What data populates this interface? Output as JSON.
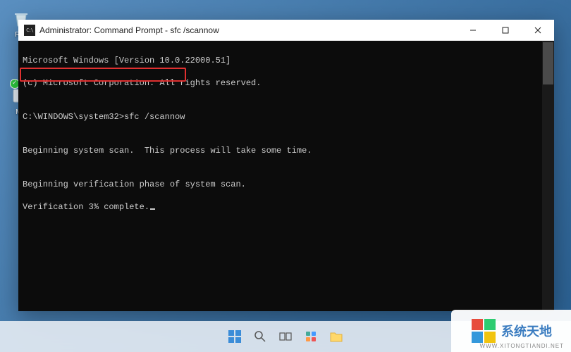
{
  "window": {
    "title": "Administrator: Command Prompt - sfc  /scannow",
    "icon_text": "C:\\"
  },
  "desktop": {
    "recycle_label": "Rec",
    "mic_label": "Mic"
  },
  "console": {
    "line1": "Microsoft Windows [Version 10.0.22000.51]",
    "line2": "(c) Microsoft Corporation. All rights reserved.",
    "blank1": "",
    "prompt_line": "C:\\WINDOWS\\system32>sfc /scannow",
    "blank2": "",
    "scan_line": "Beginning system scan.  This process will take some time.",
    "blank3": "",
    "verify_line1": "Beginning verification phase of system scan.",
    "verify_line2": "Verification 3% complete."
  },
  "watermark": {
    "text": "系统天地",
    "sub": "WWW.XITONGTIANDI.NET"
  }
}
